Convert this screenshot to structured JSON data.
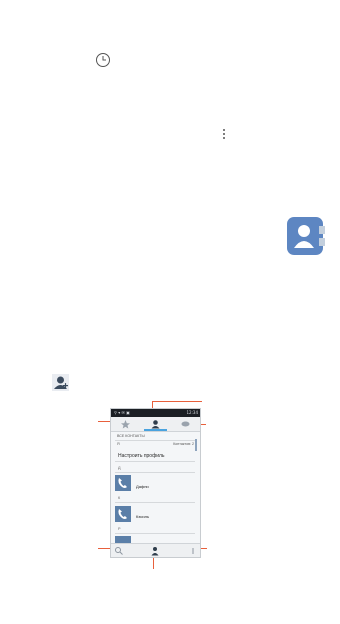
{
  "icons": {
    "history": "clock-icon",
    "overflow_menu": "vertical-dots-icon",
    "contacts_app": "contacts-app-icon",
    "add_contact": "add-contact-icon",
    "favorites": "star-icon",
    "contacts_tab": "person-icon",
    "groups": "group-icon",
    "search": "search-icon",
    "add": "person-add-icon",
    "menu": "more-icon"
  },
  "colors": {
    "callout": "#e8603c",
    "app_icon": "#5d86c2",
    "tab_accent": "#4aa3df"
  },
  "phone": {
    "status_time": "12:34",
    "section_title": "ВСЕ КОНТАКТЫ",
    "account_label": "Я",
    "contacts_count": "Контактов: 2",
    "profile_prompt": "Настроить профиль",
    "groups": [
      {
        "letter": "Д",
        "name": "Дафни"
      },
      {
        "letter": "К",
        "name": "Кэсиль"
      },
      {
        "letter": "Р",
        "name": ""
      }
    ]
  }
}
